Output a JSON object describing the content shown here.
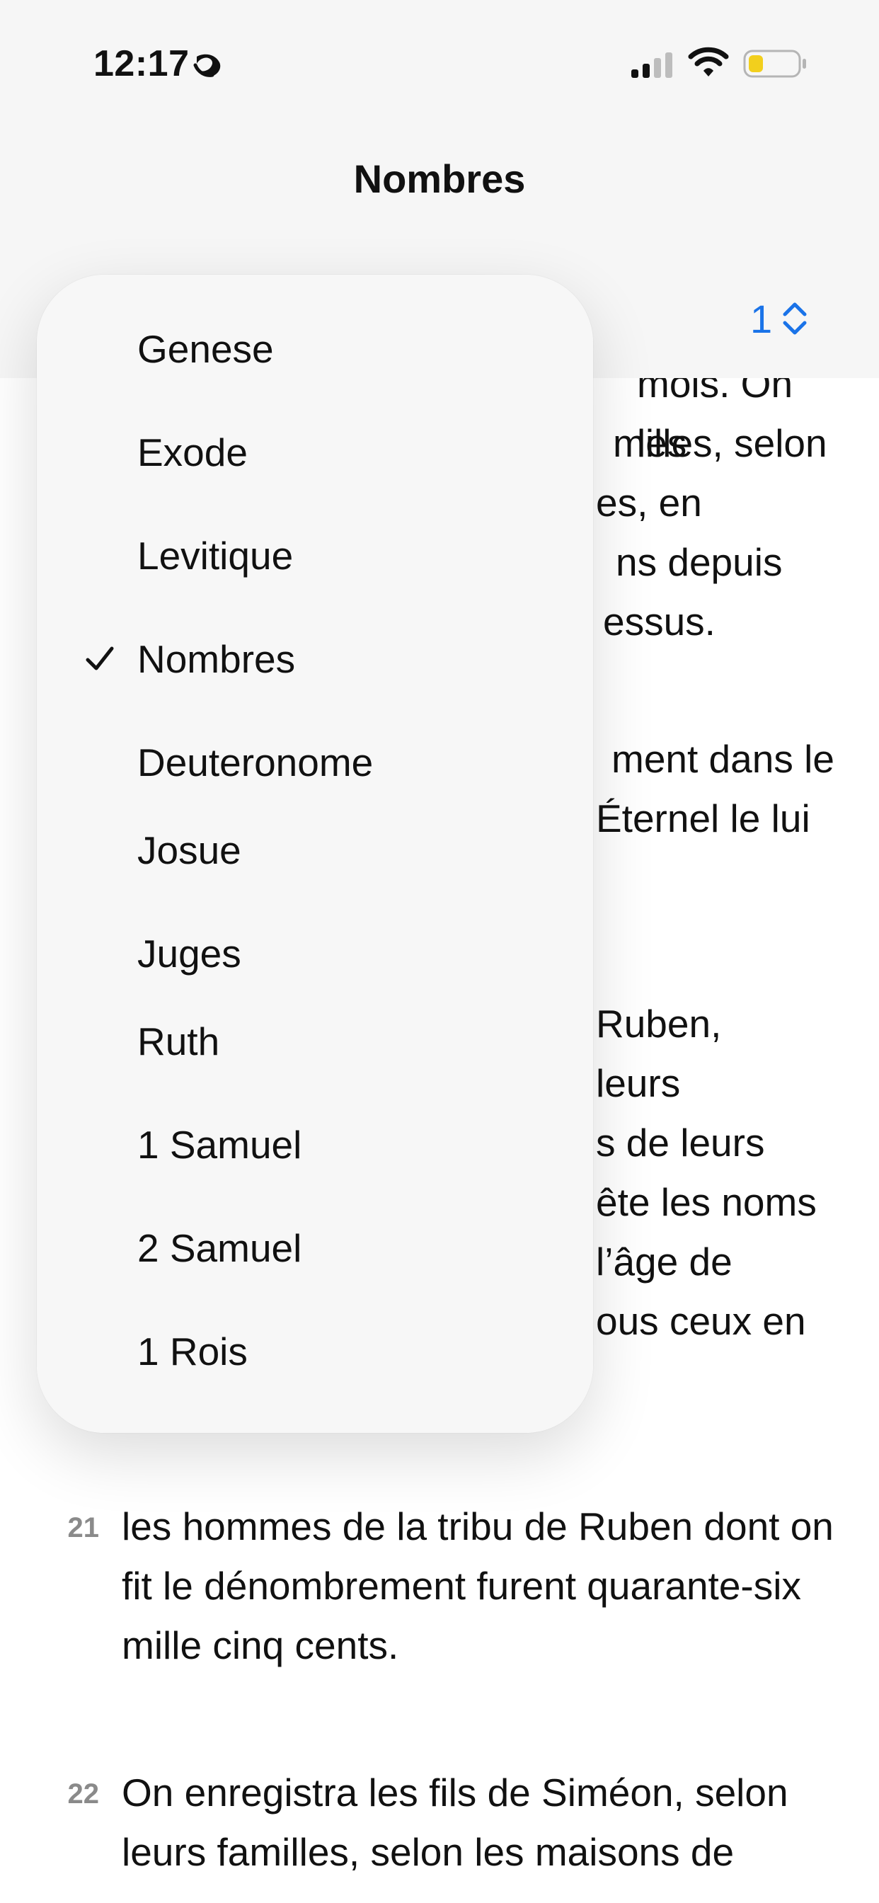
{
  "status": {
    "time": "12:17"
  },
  "nav": {
    "title": "Nombres",
    "chapter": "1"
  },
  "menu": {
    "items": [
      {
        "label": "Genese",
        "selected": false
      },
      {
        "label": "Exode",
        "selected": false
      },
      {
        "label": "Levitique",
        "selected": false
      },
      {
        "label": "Nombres",
        "selected": true
      },
      {
        "label": "Deuteronome",
        "selected": false
      },
      {
        "label": "Josue",
        "selected": false
      },
      {
        "label": "Juges",
        "selected": false
      },
      {
        "label": "Ruth",
        "selected": false
      },
      {
        "label": "1 Samuel",
        "selected": false
      },
      {
        "label": "2 Samuel",
        "selected": false
      },
      {
        "label": "1 Rois",
        "selected": false
      }
    ]
  },
  "verses_visible_fragments": {
    "v18_a": "mois. On les",
    "v18_b": "milles, selon",
    "v18_c": "es, en",
    "v18_d": "ns depuis",
    "v18_e": "essus.",
    "v19_a": "ment dans le",
    "v19_b": "Éternel le lui",
    "v20_a": "Ruben,",
    "v20_b": "leurs",
    "v20_c": "s de leurs",
    "v20_d": "ête les noms",
    "v20_e": "l’âge de",
    "v20_f": "ous ceux en"
  },
  "verses": [
    {
      "num": "21",
      "text": "les hommes de la tribu de Ruben dont on fit le dénombrement furent quarante-six mille cinq cents."
    },
    {
      "num": "22",
      "text": "On enregistra les fils de Siméon, selon leurs familles, selon les maisons de"
    }
  ]
}
